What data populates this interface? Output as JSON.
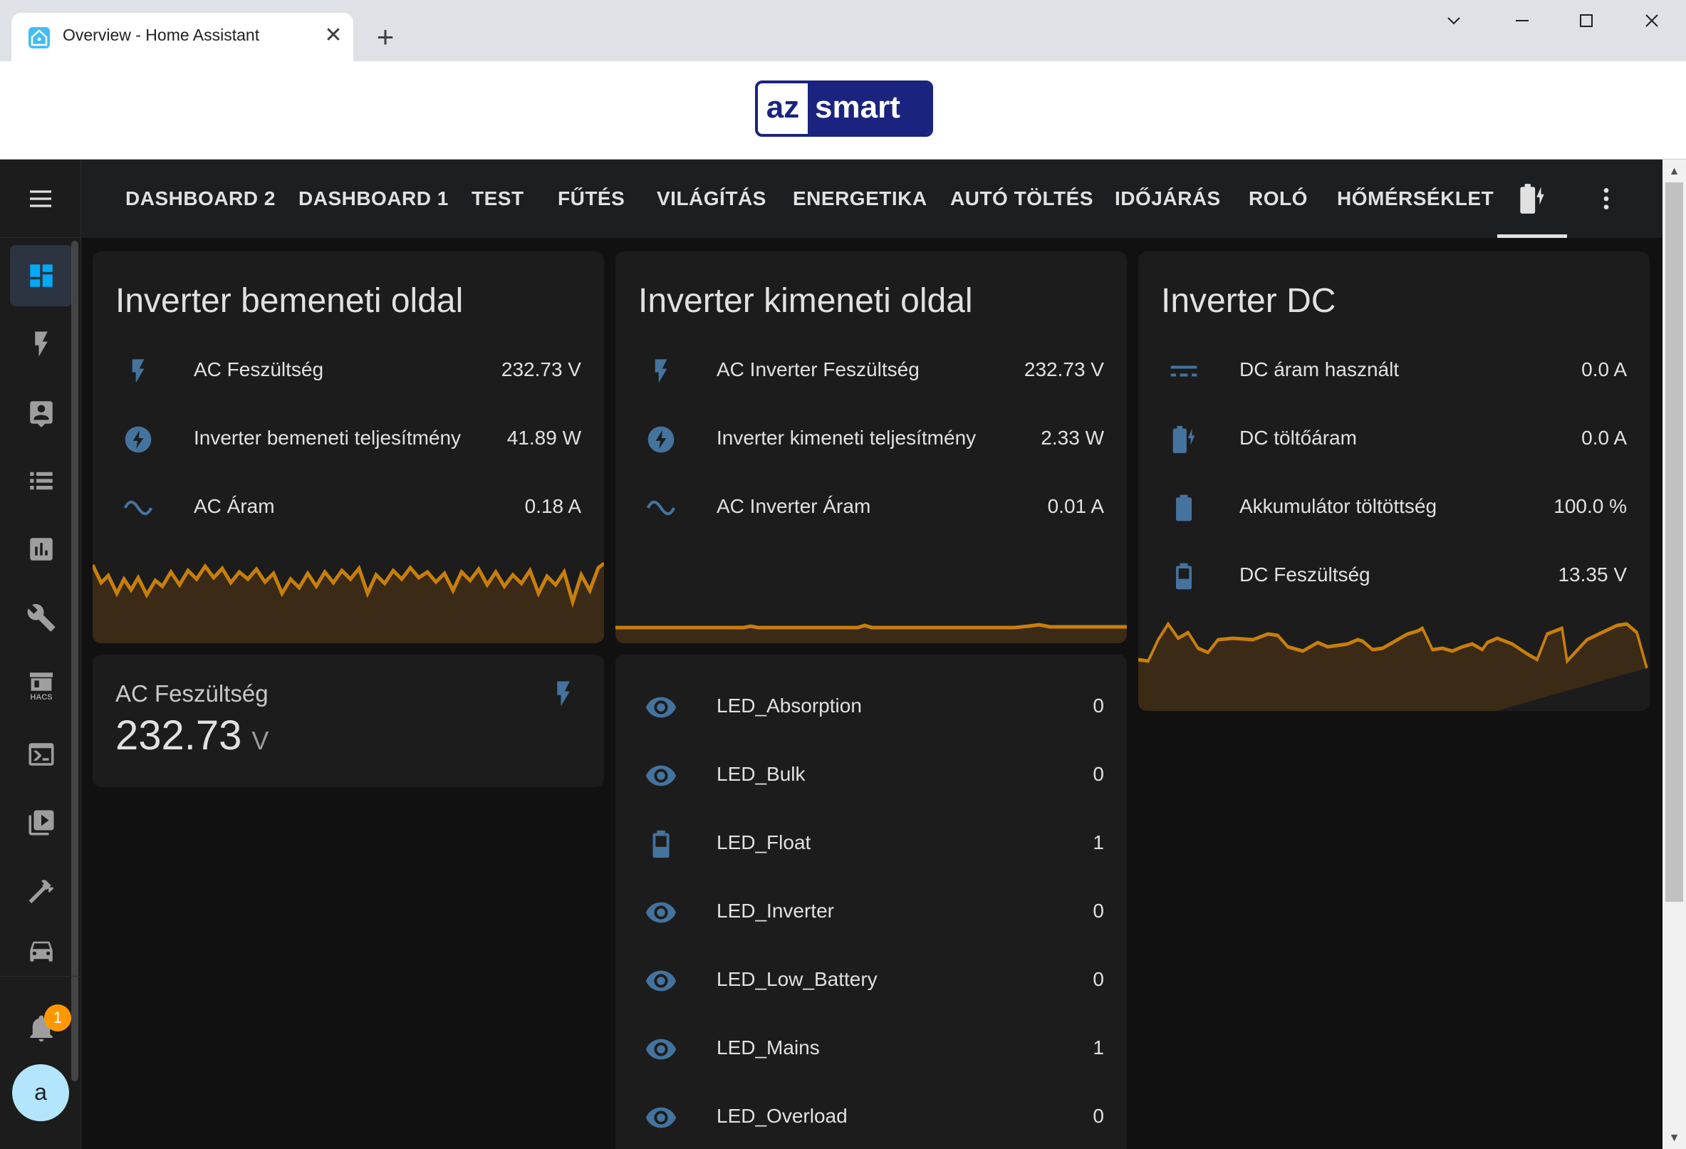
{
  "browser": {
    "tab_title": "Overview - Home Assistant",
    "close_glyph": "✕",
    "newtab_glyph": "+"
  },
  "banner": {
    "logo_left": "az",
    "logo_right": "smart"
  },
  "sidebar": {
    "notifications_count": "1",
    "avatar_initial": "a",
    "items": [
      {
        "name": "overview",
        "icon": "view-dashboard-icon"
      },
      {
        "name": "energy",
        "icon": "flash-icon"
      },
      {
        "name": "map",
        "icon": "account-box-icon"
      },
      {
        "name": "logbook",
        "icon": "format-list-icon"
      },
      {
        "name": "history",
        "icon": "chart-box-icon"
      },
      {
        "name": "settings",
        "icon": "wrench-icon"
      },
      {
        "name": "hacs",
        "icon": "hacs-store-icon"
      },
      {
        "name": "terminal",
        "icon": "console-icon"
      },
      {
        "name": "media",
        "icon": "play-box-icon"
      },
      {
        "name": "developer-tools",
        "icon": "hammer-icon"
      },
      {
        "name": "more",
        "icon": "car-icon"
      }
    ],
    "hacs_label": "HACS"
  },
  "topbar": {
    "tabs": [
      "DASHBOARD 2",
      "DASHBOARD 1",
      "TEST",
      "FŰTÉS",
      "VILÁGÍTÁS",
      "ENERGETIKA",
      "AUTÓ TÖLTÉS",
      "IDŐJÁRÁS",
      "ROLÓ",
      "HŐMÉRSÉKLET"
    ],
    "active_tab_icon": "battery-charging-icon"
  },
  "colors": {
    "accent": "#c87f0a",
    "icon_blue": "#44739e",
    "card_bg": "#1c1c1c"
  },
  "cards": {
    "input": {
      "title": "Inverter bemeneti oldal",
      "rows": [
        {
          "icon": "flash-icon",
          "label": "AC Feszültség",
          "value": "232.73 V"
        },
        {
          "icon": "flash-circle-icon",
          "label": "Inverter bemeneti teljesítmény",
          "value": "41.89 W"
        },
        {
          "icon": "sine-wave-icon",
          "label": "AC Áram",
          "value": "0.18 A"
        }
      ]
    },
    "output": {
      "title": "Inverter kimeneti oldal",
      "rows": [
        {
          "icon": "flash-icon",
          "label": "AC Inverter Feszültség",
          "value": "232.73 V"
        },
        {
          "icon": "flash-circle-icon",
          "label": "Inverter kimeneti teljesítmény",
          "value": "2.33 W"
        },
        {
          "icon": "sine-wave-icon",
          "label": "AC Inverter Áram",
          "value": "0.01 A"
        }
      ]
    },
    "dc": {
      "title": "Inverter DC",
      "rows": [
        {
          "icon": "current-dc-icon",
          "label": "DC áram használt",
          "value": "0.0 A"
        },
        {
          "icon": "battery-charging-icon",
          "label": "DC töltőáram",
          "value": "0.0 A"
        },
        {
          "icon": "battery-icon",
          "label": "Akkumulátor töltöttség",
          "value": "100.0 %"
        },
        {
          "icon": "battery-outline-icon",
          "label": "DC Feszültség",
          "value": "13.35 V"
        }
      ]
    },
    "sensor": {
      "name": "AC Feszültség",
      "value": "232.73",
      "unit": "V"
    },
    "leds": {
      "rows": [
        {
          "icon": "eye-icon",
          "label": "LED_Absorption",
          "value": "0"
        },
        {
          "icon": "eye-icon",
          "label": "LED_Bulk",
          "value": "0"
        },
        {
          "icon": "battery-outline-icon",
          "label": "LED_Float",
          "value": "1"
        },
        {
          "icon": "eye-icon",
          "label": "LED_Inverter",
          "value": "0"
        },
        {
          "icon": "eye-icon",
          "label": "LED_Low_Battery",
          "value": "0"
        },
        {
          "icon": "eye-icon",
          "label": "LED_Mains",
          "value": "1"
        },
        {
          "icon": "eye-icon",
          "label": "LED_Overload",
          "value": "0"
        }
      ]
    }
  }
}
